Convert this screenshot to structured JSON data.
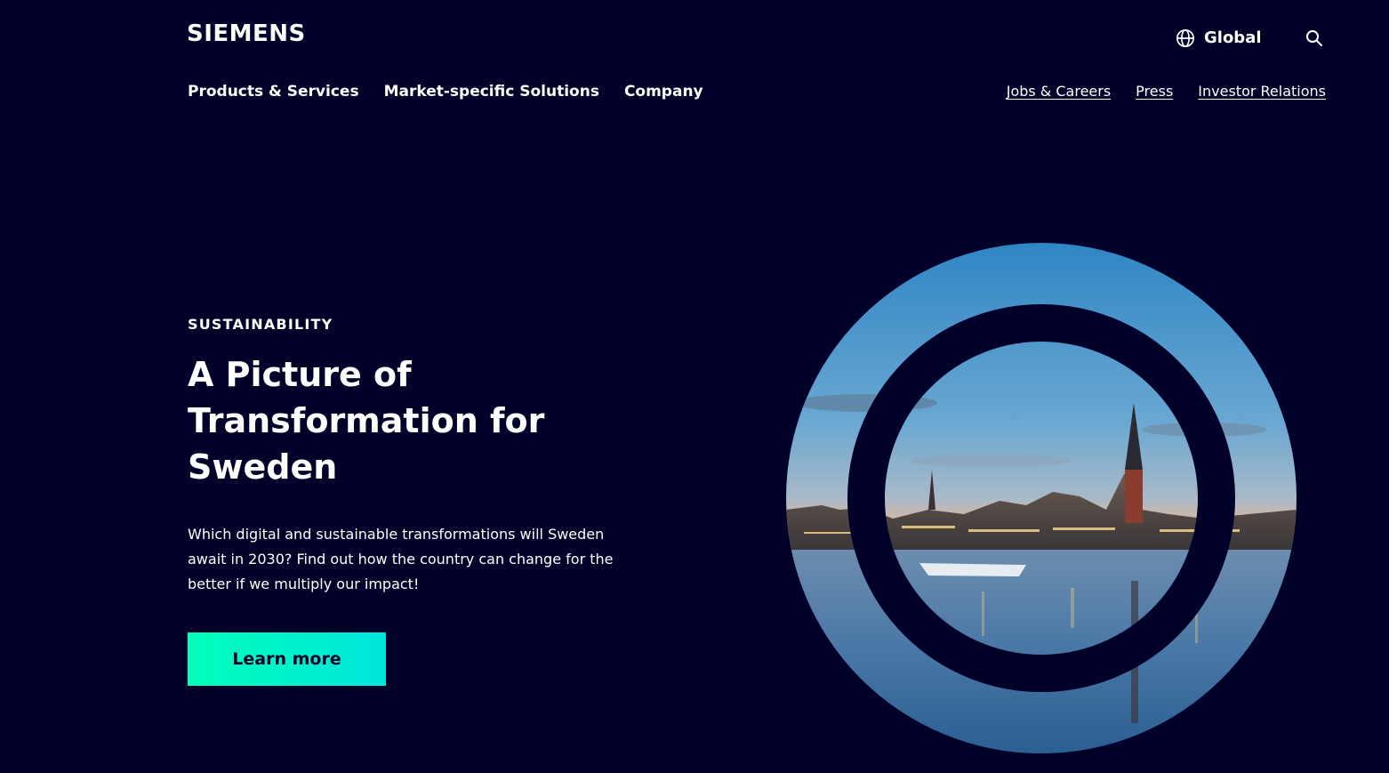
{
  "header": {
    "logo_text": "SIEMENS",
    "region_label": "Global",
    "region_icon": "globe-icon",
    "search_icon": "search-icon"
  },
  "main_nav": {
    "items": [
      {
        "label": "Products & Services"
      },
      {
        "label": "Market-specific Solutions"
      },
      {
        "label": "Company"
      }
    ]
  },
  "secondary_nav": {
    "items": [
      {
        "label": "Jobs & Careers"
      },
      {
        "label": "Press"
      },
      {
        "label": "Investor Relations"
      }
    ]
  },
  "hero": {
    "eyebrow": "SUSTAINABILITY",
    "title": "A Picture of Transformation for Sweden",
    "description": "Which digital and sustainable transformations will Sweden await in 2030? Find out how the country can change for the better if we multiply our impact!",
    "cta_label": "Learn more",
    "image_subject": "Stockholm city skyline at dusk reflected in water, framed in concentric rings"
  },
  "colors": {
    "background": "#000028",
    "text": "#ffffff",
    "cta_gradient_start": "#00ffb9",
    "cta_gradient_end": "#00e6dc",
    "cta_text": "#000028"
  }
}
